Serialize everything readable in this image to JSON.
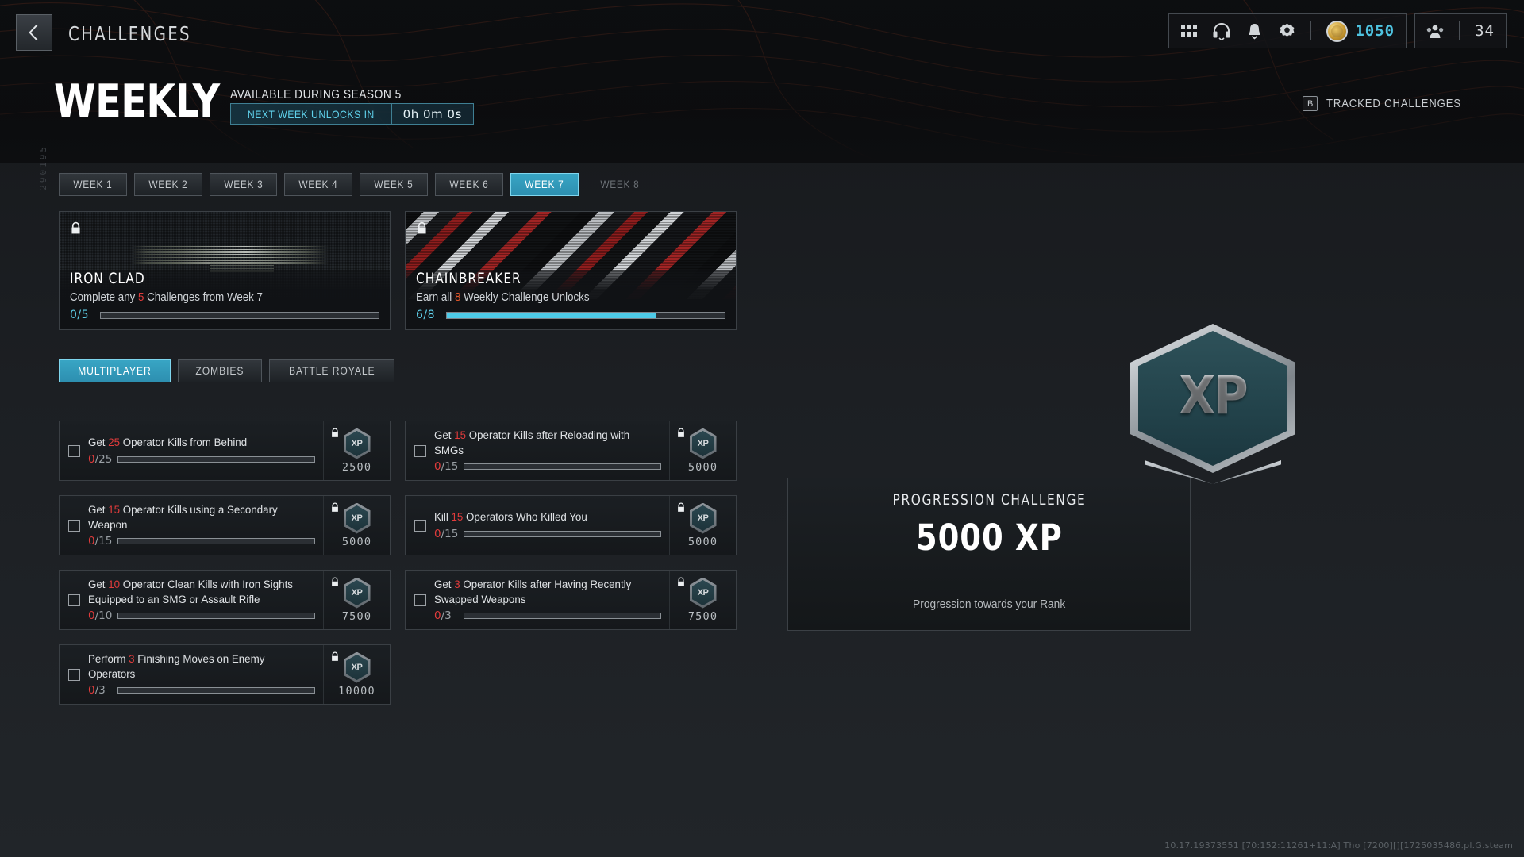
{
  "header": {
    "back_icon": "chevron-left-icon",
    "title": "CHALLENGES",
    "hud": {
      "grid_icon": "grid-apps-icon",
      "headset_icon": "headset-icon",
      "bell_icon": "notification-bell-icon",
      "gear_icon": "settings-gear-icon",
      "coin_icon": "cod-points-coin-icon",
      "coin_value": "1050",
      "squad_icon": "squad-players-icon",
      "squad_value": "34"
    }
  },
  "banner": {
    "side_code": "290195",
    "title": "WEEKLY",
    "availability": "AVAILABLE DURING SEASON 5",
    "timer_label": "NEXT WEEK UNLOCKS IN",
    "timer_value": "0h 0m 0s",
    "tracked_key": "B",
    "tracked_label": "TRACKED CHALLENGES"
  },
  "week_tabs": [
    {
      "label": "WEEK 1",
      "state": "normal"
    },
    {
      "label": "WEEK 2",
      "state": "normal"
    },
    {
      "label": "WEEK 3",
      "state": "normal"
    },
    {
      "label": "WEEK 4",
      "state": "normal"
    },
    {
      "label": "WEEK 5",
      "state": "normal"
    },
    {
      "label": "WEEK 6",
      "state": "normal"
    },
    {
      "label": "WEEK 7",
      "state": "selected"
    },
    {
      "label": "WEEK 8",
      "state": "locked"
    }
  ],
  "rewards": [
    {
      "name": "IRON CLAD",
      "desc_pre": "Complete any ",
      "desc_num": "5",
      "desc_post": " Challenges from Week 7",
      "progress_text": "0/5",
      "progress_pct": 0,
      "lock_icon": "lock-icon",
      "art": "weapon-blueprint-art"
    },
    {
      "name": "CHAINBREAKER",
      "desc_pre": "Earn all ",
      "desc_num": "8",
      "desc_post": " Weekly Challenge Unlocks",
      "progress_text": "6/8",
      "progress_pct": 75,
      "lock_icon": "lock-icon",
      "art": "camo-pattern-art"
    }
  ],
  "category_tabs": [
    {
      "label": "MULTIPLAYER",
      "state": "selected"
    },
    {
      "label": "ZOMBIES",
      "state": "normal"
    },
    {
      "label": "BATTLE ROYALE",
      "state": "normal"
    }
  ],
  "challenges": [
    {
      "pre": "Get ",
      "num": "25",
      "post": " Operator Kills from Behind",
      "current": "0",
      "target": "/25",
      "pct": 0,
      "xp": "2500",
      "badge": "XP",
      "lock_icon": "lock-icon"
    },
    {
      "pre": "Get ",
      "num": "15",
      "post": " Operator Kills after Reloading with SMGs",
      "current": "0",
      "target": "/15",
      "pct": 0,
      "xp": "5000",
      "badge": "XP",
      "lock_icon": "lock-icon"
    },
    {
      "pre": "Get ",
      "num": "15",
      "post": " Operator Kills using a Secondary Weapon",
      "current": "0",
      "target": "/15",
      "pct": 0,
      "xp": "5000",
      "badge": "XP",
      "lock_icon": "lock-icon"
    },
    {
      "pre": "Kill ",
      "num": "15",
      "post": " Operators Who Killed You",
      "current": "0",
      "target": "/15",
      "pct": 0,
      "xp": "5000",
      "badge": "XP",
      "lock_icon": "lock-icon"
    },
    {
      "pre": "Get ",
      "num": "10",
      "post": " Operator Clean Kills with Iron Sights Equipped to an SMG or Assault Rifle",
      "current": "0",
      "target": "/10",
      "pct": 0,
      "xp": "7500",
      "badge": "XP",
      "lock_icon": "lock-icon"
    },
    {
      "pre": "Get ",
      "num": "3",
      "post": " Operator Kills after Having Recently Swapped Weapons",
      "current": "0",
      "target": "/3",
      "pct": 0,
      "xp": "7500",
      "badge": "XP",
      "lock_icon": "lock-icon"
    },
    {
      "pre": "Perform ",
      "num": "3",
      "post": " Finishing Moves on Enemy Operators",
      "current": "0",
      "target": "/3",
      "pct": 0,
      "xp": "10000",
      "badge": "XP",
      "lock_icon": "lock-icon"
    }
  ],
  "right_panel": {
    "emblem_text": "XP",
    "card_title": "PROGRESSION CHALLENGE",
    "card_amount": "5000 XP",
    "card_subtitle": "Progression towards your Rank"
  },
  "footer": {
    "build": "10.17.19373551 [70:152:11261+11:A] Tho [7200][][1725035486.pl.G.steam"
  },
  "colors": {
    "accent_cyan": "#38a5c4",
    "progress_cyan": "#4ecbe8",
    "highlight_red": "#e03b3b",
    "coin_cyan": "#4ec3e0"
  }
}
